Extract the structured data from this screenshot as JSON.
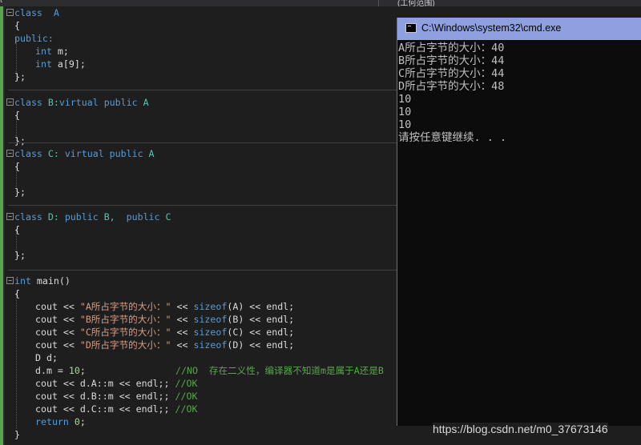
{
  "top": {
    "left_text": "t",
    "right_text": "(工何范围)"
  },
  "code": {
    "class_a": "class  A",
    "brace_open": "{",
    "public": "public:",
    "int_m_kw": "int",
    "int_m_rest": " m;",
    "int_a_kw": "int",
    "int_a_rest": " a[9];",
    "brace_close": "};",
    "class_b_kw1": "class",
    "class_b_name": " B:",
    "class_b_kw2": "virtual public",
    "class_b_base": " A",
    "class_c_kw1": "class",
    "class_c_name": " C: ",
    "class_c_kw2": "virtual public",
    "class_c_base": " A",
    "class_d_kw1": "class",
    "class_d_name": " D: ",
    "class_d_kw2": "public",
    "class_d_b": " B,  ",
    "class_d_kw3": "public",
    "class_d_c": " C",
    "main_kw": "int",
    "main_rest": " main()",
    "cout": "cout << ",
    "str_a": "\"A所占字节的大小：\"",
    "str_b": "\"B所占字节的大小：\"",
    "str_c": "\"C所占字节的大小：\"",
    "str_d": "\"D所占字节的大小：\"",
    "lt": " << ",
    "sizeof": "sizeof",
    "sa": "(A)",
    "sb": "(B)",
    "sc": "(C)",
    "sd": "(D)",
    "endl": " << endl;",
    "dd": "D d;",
    "dm_left": "d.m = ",
    "dm_num": "10",
    "dm_semi": ";",
    "dm_comment": "//NO  存在二义性，编译器不知道m是属于A还是B",
    "cout_da": "cout << d.A::m << endl;; ",
    "cout_db": "cout << d.B::m << endl;; ",
    "cout_dc": "cout << d.C::m << endl;; ",
    "comment_ok": "//OK",
    "ret_kw": "return",
    "ret_num": " 0",
    "ret_semi": ";",
    "main_close": "}"
  },
  "console": {
    "title": "C:\\Windows\\system32\\cmd.exe",
    "lines": [
      "A所占字节的大小：40",
      "B所占字节的大小：44",
      "C所占字节的大小：44",
      "D所占字节的大小：48",
      "10",
      "10",
      "10",
      "请按任意键继续. . ."
    ]
  },
  "watermark": "https://blog.csdn.net/m0_37673146"
}
